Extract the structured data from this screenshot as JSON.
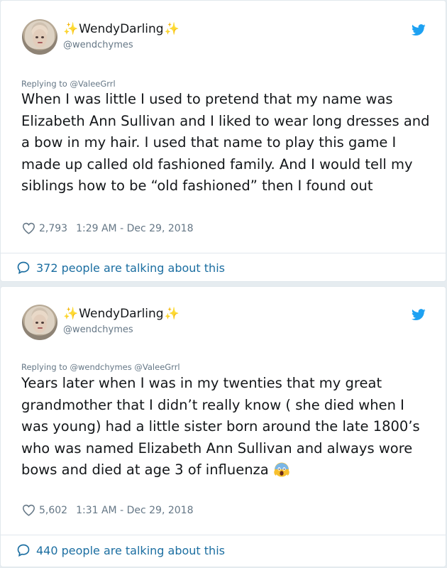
{
  "tweets": [
    {
      "display_name": "WendyDarling",
      "handle": "@wendchymes",
      "replying_to": "Replying to @ValeeGrrl",
      "text": "When I was little I used to pretend that my name was Elizabeth Ann Sullivan and I liked to wear long dresses and a bow in my hair.  I used that name to play this game I made up called old fashioned family. And I would tell my siblings how to be “old fashioned” then I found out",
      "likes": "2,793",
      "time": "1:29 AM - Dec 29, 2018",
      "talking": "372 people are talking about this"
    },
    {
      "display_name": "WendyDarling",
      "handle": "@wendchymes",
      "replying_to": "Replying to @wendchymes @ValeeGrrl",
      "text": "Years later when I was in my twenties that my great grandmother that I didn’t really know ( she died when I was young) had a little sister born around the late 1800’s who was named Elizabeth Ann Sullivan and always wore bows and died at age 3 of influenza",
      "likes": "5,602",
      "time": "1:31 AM - Dec 29, 2018",
      "talking": "440 people are talking about this"
    }
  ],
  "colors": {
    "background": "#e6ecf0",
    "text": "#14171a",
    "muted": "#657786",
    "link": "#1b6ea1",
    "twitter_blue": "#1da1f2",
    "sparkle": "#f5c518"
  },
  "icons": [
    "sparkles-icon",
    "twitter-bird-icon",
    "heart-icon",
    "comment-bubble-icon",
    "screaming-face-emoji"
  ]
}
